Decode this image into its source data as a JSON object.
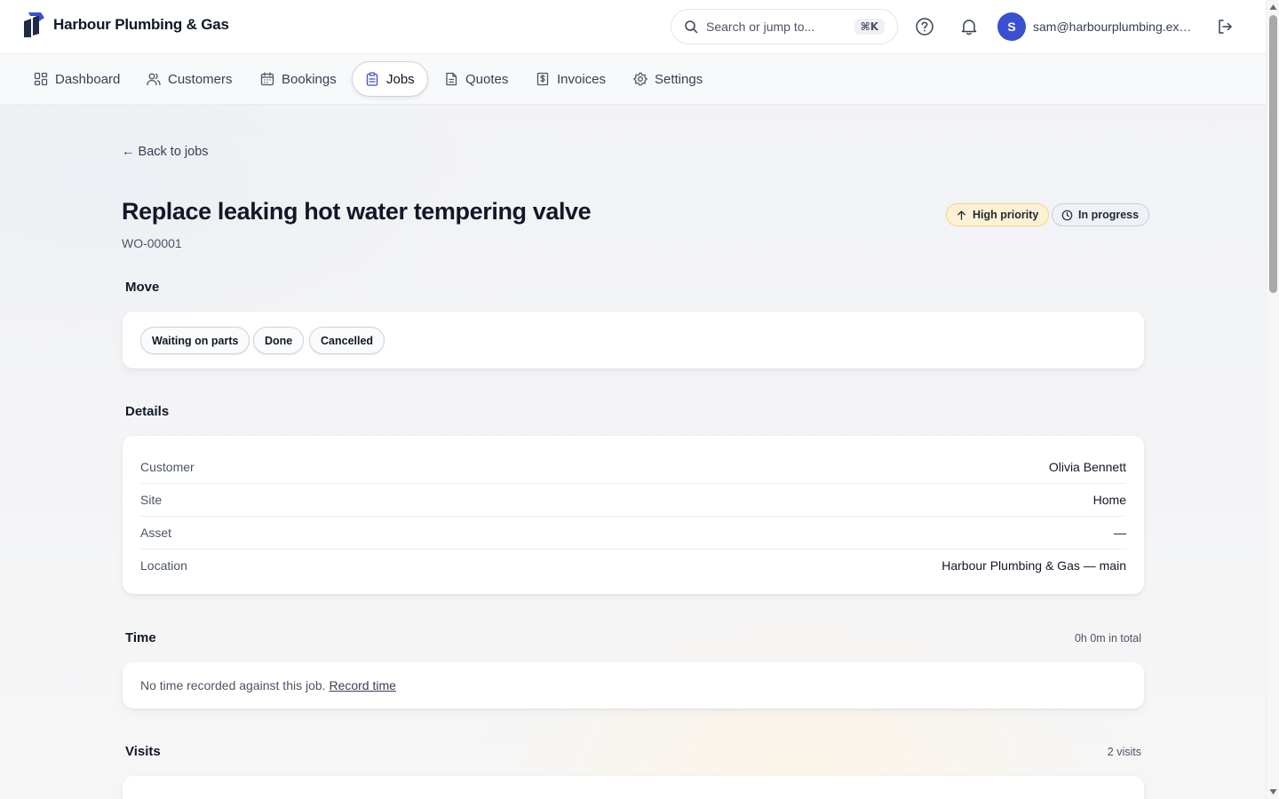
{
  "app": {
    "name": "Harbour Plumbing & Gas"
  },
  "header": {
    "search_placeholder": "Search or jump to...",
    "search_shortcut": "⌘K",
    "user_initial": "S",
    "user_email": "sam@harbourplumbing.example"
  },
  "nav": {
    "items": [
      {
        "label": "Dashboard",
        "icon": "dashboard-icon"
      },
      {
        "label": "Customers",
        "icon": "users-icon"
      },
      {
        "label": "Bookings",
        "icon": "calendar-icon"
      },
      {
        "label": "Jobs",
        "icon": "clipboard-icon",
        "active": true
      },
      {
        "label": "Quotes",
        "icon": "document-icon"
      },
      {
        "label": "Invoices",
        "icon": "invoice-icon"
      },
      {
        "label": "Settings",
        "icon": "gear-icon"
      }
    ]
  },
  "page": {
    "back_label": "← Back to jobs",
    "title": "Replace leaking hot water tempering valve",
    "job_id": "WO-00001",
    "priority_label": "High priority",
    "status_label": "In progress"
  },
  "move": {
    "title": "Move",
    "options": [
      "Waiting on parts",
      "Done",
      "Cancelled"
    ]
  },
  "details": {
    "title": "Details",
    "rows": [
      {
        "label": "Customer",
        "value": "Olivia Bennett"
      },
      {
        "label": "Site",
        "value": "Home"
      },
      {
        "label": "Asset",
        "value": "—"
      },
      {
        "label": "Location",
        "value": "Harbour Plumbing & Gas — main"
      }
    ]
  },
  "time": {
    "title": "Time",
    "total": "0h 0m in total",
    "empty_text": "No time recorded against this job.",
    "record_link": "Record time"
  },
  "visits": {
    "title": "Visits",
    "count": "2 visits"
  },
  "colors": {
    "accent": "#3b4fd1",
    "priority_bg": "#fdf1d3",
    "status_bg": "#eef1f6"
  }
}
